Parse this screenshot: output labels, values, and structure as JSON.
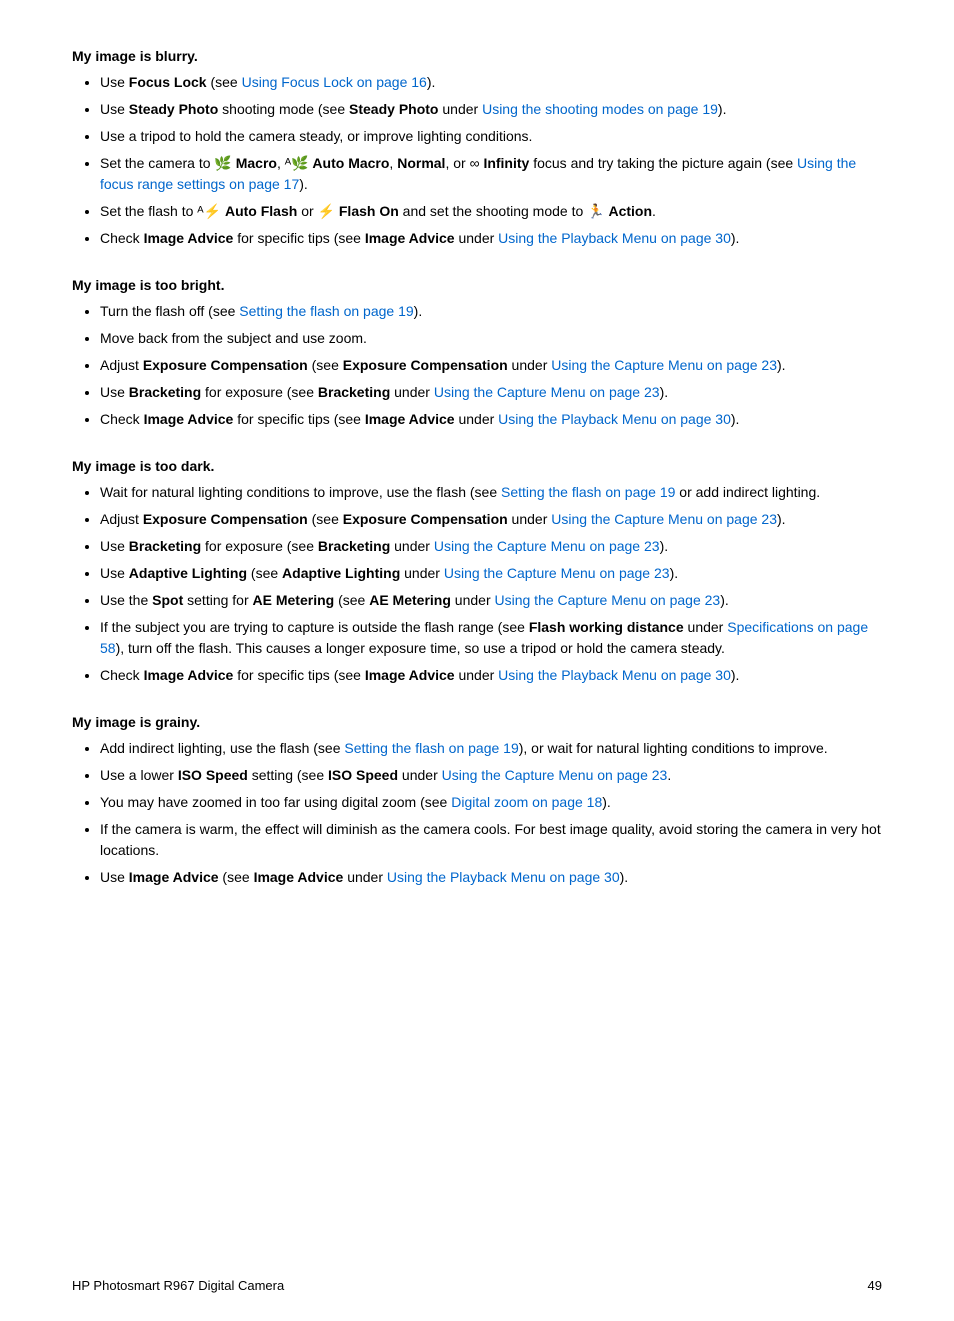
{
  "sections": [
    {
      "id": "blurry",
      "title": "My image is blurry.",
      "items": [
        {
          "parts": [
            {
              "type": "text",
              "text": "Use "
            },
            {
              "type": "bold",
              "text": "Focus Lock"
            },
            {
              "type": "text",
              "text": " (see "
            },
            {
              "type": "link",
              "text": "Using Focus Lock on page 16"
            },
            {
              "type": "text",
              "text": ")."
            }
          ]
        },
        {
          "parts": [
            {
              "type": "text",
              "text": "Use "
            },
            {
              "type": "bold",
              "text": "Steady Photo"
            },
            {
              "type": "text",
              "text": " shooting mode (see "
            },
            {
              "type": "bold",
              "text": "Steady Photo"
            },
            {
              "type": "text",
              "text": " under "
            },
            {
              "type": "link",
              "text": "Using the shooting modes on page 19"
            },
            {
              "type": "text",
              "text": ")."
            }
          ]
        },
        {
          "parts": [
            {
              "type": "text",
              "text": "Use a tripod to hold the camera steady, or improve lighting conditions."
            }
          ]
        },
        {
          "parts": [
            {
              "type": "text",
              "text": "Set the camera to "
            },
            {
              "type": "icon",
              "text": "🌿"
            },
            {
              "type": "text",
              "text": " "
            },
            {
              "type": "bold",
              "text": "Macro"
            },
            {
              "type": "text",
              "text": ", "
            },
            {
              "type": "icon",
              "text": "ᴬ🌿"
            },
            {
              "type": "text",
              "text": " "
            },
            {
              "type": "bold",
              "text": "Auto Macro"
            },
            {
              "type": "text",
              "text": ", "
            },
            {
              "type": "bold",
              "text": "Normal"
            },
            {
              "type": "text",
              "text": ", or "
            },
            {
              "type": "icon",
              "text": "∞"
            },
            {
              "type": "text",
              "text": " "
            },
            {
              "type": "bold",
              "text": "Infinity"
            },
            {
              "type": "text",
              "text": " focus and try taking the picture again (see "
            },
            {
              "type": "link",
              "text": "Using the focus range settings on page 17"
            },
            {
              "type": "text",
              "text": ")."
            }
          ]
        },
        {
          "parts": [
            {
              "type": "text",
              "text": "Set the flash to "
            },
            {
              "type": "icon",
              "text": "ᴬ⚡"
            },
            {
              "type": "text",
              "text": " "
            },
            {
              "type": "bold",
              "text": "Auto Flash"
            },
            {
              "type": "text",
              "text": " or "
            },
            {
              "type": "icon",
              "text": "⚡"
            },
            {
              "type": "text",
              "text": " "
            },
            {
              "type": "bold",
              "text": "Flash On"
            },
            {
              "type": "text",
              "text": " and set the shooting mode to "
            },
            {
              "type": "icon",
              "text": "🏃"
            },
            {
              "type": "text",
              "text": " "
            },
            {
              "type": "bold",
              "text": "Action"
            },
            {
              "type": "text",
              "text": "."
            }
          ]
        },
        {
          "parts": [
            {
              "type": "text",
              "text": "Check "
            },
            {
              "type": "bold",
              "text": "Image Advice"
            },
            {
              "type": "text",
              "text": " for specific tips (see "
            },
            {
              "type": "bold",
              "text": "Image Advice"
            },
            {
              "type": "text",
              "text": " under "
            },
            {
              "type": "link",
              "text": "Using the Playback Menu on page 30"
            },
            {
              "type": "text",
              "text": ")."
            }
          ]
        }
      ]
    },
    {
      "id": "too-bright",
      "title": "My image is too bright.",
      "items": [
        {
          "parts": [
            {
              "type": "text",
              "text": "Turn the flash off (see "
            },
            {
              "type": "link",
              "text": "Setting the flash on page 19"
            },
            {
              "type": "text",
              "text": ")."
            }
          ]
        },
        {
          "parts": [
            {
              "type": "text",
              "text": "Move back from the subject and use zoom."
            }
          ]
        },
        {
          "parts": [
            {
              "type": "text",
              "text": "Adjust "
            },
            {
              "type": "bold",
              "text": "Exposure Compensation"
            },
            {
              "type": "text",
              "text": " (see "
            },
            {
              "type": "bold",
              "text": "Exposure Compensation"
            },
            {
              "type": "text",
              "text": " under "
            },
            {
              "type": "link",
              "text": "Using the Capture Menu on page 23"
            },
            {
              "type": "text",
              "text": ")."
            }
          ]
        },
        {
          "parts": [
            {
              "type": "text",
              "text": "Use "
            },
            {
              "type": "bold",
              "text": "Bracketing"
            },
            {
              "type": "text",
              "text": " for exposure (see "
            },
            {
              "type": "bold",
              "text": "Bracketing"
            },
            {
              "type": "text",
              "text": " under "
            },
            {
              "type": "link",
              "text": "Using the Capture Menu on page 23"
            },
            {
              "type": "text",
              "text": ")."
            }
          ]
        },
        {
          "parts": [
            {
              "type": "text",
              "text": "Check "
            },
            {
              "type": "bold",
              "text": "Image Advice"
            },
            {
              "type": "text",
              "text": " for specific tips (see "
            },
            {
              "type": "bold",
              "text": "Image Advice"
            },
            {
              "type": "text",
              "text": " under "
            },
            {
              "type": "link",
              "text": "Using the Playback Menu on page 30"
            },
            {
              "type": "text",
              "text": ")."
            }
          ]
        }
      ]
    },
    {
      "id": "too-dark",
      "title": "My image is too dark.",
      "items": [
        {
          "parts": [
            {
              "type": "text",
              "text": "Wait for natural lighting conditions to improve, use the flash (see "
            },
            {
              "type": "link",
              "text": "Setting the flash on page 19"
            },
            {
              "type": "text",
              "text": " or add indirect lighting."
            }
          ]
        },
        {
          "parts": [
            {
              "type": "text",
              "text": "Adjust "
            },
            {
              "type": "bold",
              "text": "Exposure Compensation"
            },
            {
              "type": "text",
              "text": " (see "
            },
            {
              "type": "bold",
              "text": "Exposure Compensation"
            },
            {
              "type": "text",
              "text": " under "
            },
            {
              "type": "link",
              "text": "Using the Capture Menu on page 23"
            },
            {
              "type": "text",
              "text": ")."
            }
          ]
        },
        {
          "parts": [
            {
              "type": "text",
              "text": "Use "
            },
            {
              "type": "bold",
              "text": "Bracketing"
            },
            {
              "type": "text",
              "text": " for exposure (see "
            },
            {
              "type": "bold",
              "text": "Bracketing"
            },
            {
              "type": "text",
              "text": " under "
            },
            {
              "type": "link",
              "text": "Using the Capture Menu on page 23"
            },
            {
              "type": "text",
              "text": ")."
            }
          ]
        },
        {
          "parts": [
            {
              "type": "text",
              "text": "Use "
            },
            {
              "type": "bold",
              "text": "Adaptive Lighting"
            },
            {
              "type": "text",
              "text": " (see "
            },
            {
              "type": "bold",
              "text": "Adaptive Lighting"
            },
            {
              "type": "text",
              "text": " under "
            },
            {
              "type": "link",
              "text": "Using the Capture Menu on page 23"
            },
            {
              "type": "text",
              "text": ")."
            }
          ]
        },
        {
          "parts": [
            {
              "type": "text",
              "text": "Use the "
            },
            {
              "type": "bold",
              "text": "Spot"
            },
            {
              "type": "text",
              "text": " setting for "
            },
            {
              "type": "bold",
              "text": "AE Metering"
            },
            {
              "type": "text",
              "text": " (see "
            },
            {
              "type": "bold",
              "text": "AE Metering"
            },
            {
              "type": "text",
              "text": " under "
            },
            {
              "type": "link",
              "text": "Using the Capture Menu on page 23"
            },
            {
              "type": "text",
              "text": ")."
            }
          ]
        },
        {
          "parts": [
            {
              "type": "text",
              "text": "If the subject you are trying to capture is outside the flash range (see "
            },
            {
              "type": "bold",
              "text": "Flash working distance"
            },
            {
              "type": "text",
              "text": " under "
            },
            {
              "type": "link",
              "text": "Specifications on page 58"
            },
            {
              "type": "text",
              "text": "), turn off the flash. This causes a longer exposure time, so use a tripod or hold the camera steady."
            }
          ]
        },
        {
          "parts": [
            {
              "type": "text",
              "text": "Check "
            },
            {
              "type": "bold",
              "text": "Image Advice"
            },
            {
              "type": "text",
              "text": " for specific tips (see "
            },
            {
              "type": "bold",
              "text": "Image Advice"
            },
            {
              "type": "text",
              "text": " under "
            },
            {
              "type": "link",
              "text": "Using the Playback Menu on page 30"
            },
            {
              "type": "text",
              "text": ")."
            }
          ]
        }
      ]
    },
    {
      "id": "grainy",
      "title": "My image is grainy.",
      "items": [
        {
          "parts": [
            {
              "type": "text",
              "text": "Add indirect lighting, use the flash (see "
            },
            {
              "type": "link",
              "text": "Setting the flash on page 19"
            },
            {
              "type": "text",
              "text": "), or wait for natural lighting conditions to improve."
            }
          ]
        },
        {
          "parts": [
            {
              "type": "text",
              "text": "Use a lower "
            },
            {
              "type": "bold",
              "text": "ISO Speed"
            },
            {
              "type": "text",
              "text": " setting (see "
            },
            {
              "type": "bold",
              "text": "ISO Speed"
            },
            {
              "type": "text",
              "text": " under "
            },
            {
              "type": "link",
              "text": "Using the Capture Menu on page 23"
            },
            {
              "type": "text",
              "text": "."
            }
          ]
        },
        {
          "parts": [
            {
              "type": "text",
              "text": "You may have zoomed in too far using digital zoom (see "
            },
            {
              "type": "link",
              "text": "Digital zoom on page 18"
            },
            {
              "type": "text",
              "text": ")."
            }
          ]
        },
        {
          "parts": [
            {
              "type": "text",
              "text": "If the camera is warm, the effect will diminish as the camera cools. For best image quality, avoid storing the camera in very hot locations."
            }
          ]
        },
        {
          "parts": [
            {
              "type": "text",
              "text": "Use "
            },
            {
              "type": "bold",
              "text": "Image Advice"
            },
            {
              "type": "text",
              "text": " (see "
            },
            {
              "type": "bold",
              "text": "Image Advice"
            },
            {
              "type": "text",
              "text": " under "
            },
            {
              "type": "link",
              "text": "Using the Playback Menu on page 30"
            },
            {
              "type": "text",
              "text": ")."
            }
          ]
        }
      ]
    }
  ],
  "footer": {
    "left": "HP Photosmart R967 Digital Camera",
    "right": "49"
  }
}
